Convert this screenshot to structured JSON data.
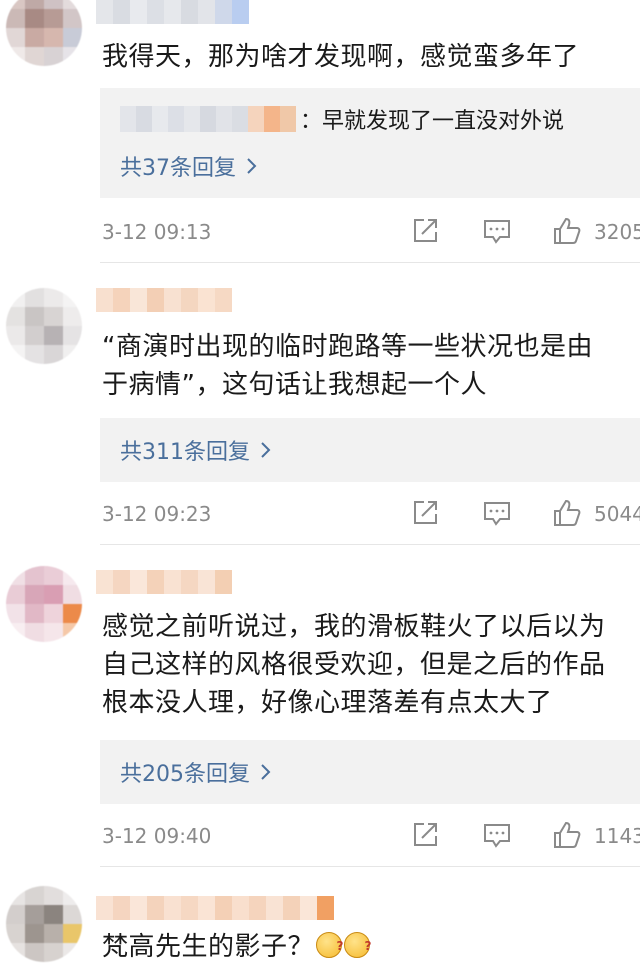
{
  "comments": [
    {
      "text_lines": [
        "我得天，那为啥才发现啊，感觉蛮多年了"
      ],
      "reply_preview": "：早就发现了一直没对外说",
      "reply_count_label": "共37条回复",
      "timestamp": "3-12 09:13",
      "likes": "3205"
    },
    {
      "text_lines": [
        "“商演时出现的临时跑路等一些状况也是由",
        "于病情”，这句话让我想起一个人"
      ],
      "reply_count_label": "共311条回复",
      "timestamp": "3-12 09:23",
      "likes": "5044"
    },
    {
      "text_lines": [
        "感觉之前听说过，我的滑板鞋火了以后以为",
        "自己这样的风格很受欢迎，但是之后的作品",
        "根本没人理，好像心理落差有点太大了"
      ],
      "reply_count_label": "共205条回复",
      "timestamp": "3-12 09:40",
      "likes": "1143"
    },
    {
      "text_lines": [
        "梵高先生的影子？"
      ],
      "emoji_icons": [
        "thinking-emoji-icon",
        "thinking-emoji-icon"
      ]
    }
  ],
  "colors": {
    "reply_link": "#4a6f9c",
    "reply_bg": "#f2f2f2",
    "meta_gray": "#8a8a8a"
  },
  "icons": [
    "share-icon",
    "comment-icon",
    "like-icon",
    "chevron-right-icon"
  ]
}
